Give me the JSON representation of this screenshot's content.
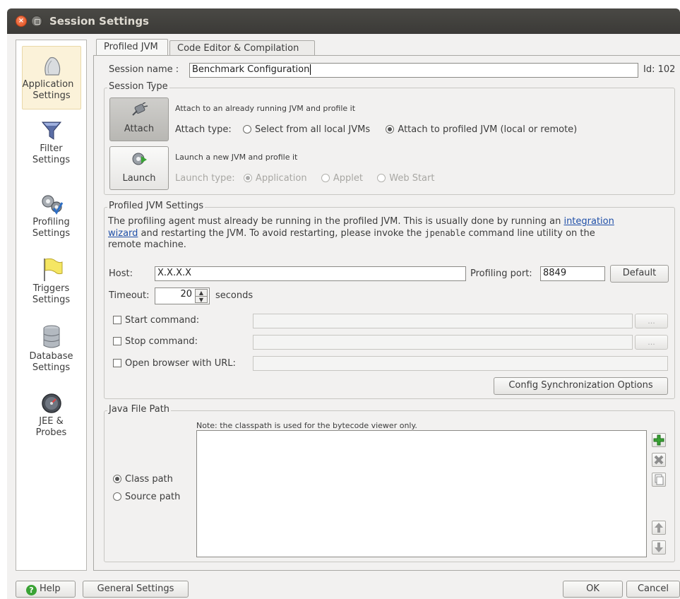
{
  "window": {
    "title": "Session Settings"
  },
  "sidebar": {
    "items": [
      {
        "label_line1": "Application",
        "label_line2": "Settings"
      },
      {
        "label_line1": "Filter",
        "label_line2": "Settings"
      },
      {
        "label_line1": "Profiling",
        "label_line2": "Settings"
      },
      {
        "label_line1": "Triggers",
        "label_line2": "Settings"
      },
      {
        "label_line1": "Database",
        "label_line2": "Settings"
      },
      {
        "label_line1": "JEE &",
        "label_line2": "Probes"
      }
    ]
  },
  "tabs": [
    {
      "label": "Profiled JVM"
    },
    {
      "label": "Code Editor & Compilation"
    }
  ],
  "session": {
    "name_label": "Session name :",
    "name_value": "Benchmark Configuration",
    "id_label": "Id: 102"
  },
  "session_type": {
    "title": "Session Type",
    "attach_button": "Attach",
    "attach_desc": "Attach to an already running JVM and profile it",
    "attach_type_label": "Attach type:",
    "attach_option_1": "Select from all local JVMs",
    "attach_option_2": "Attach to profiled JVM (local or remote)",
    "launch_button": "Launch",
    "launch_desc": "Launch a new JVM and profile it",
    "launch_type_label": "Launch type:",
    "launch_option_1": "Application",
    "launch_option_2": "Applet",
    "launch_option_3": "Web Start"
  },
  "profiled_jvm": {
    "title": "Profiled JVM Settings",
    "desc_1": "The profiling agent must already be running in the profiled JVM. This is usually done by running an",
    "link_1": "integration",
    "link_2": "wizard",
    "desc_2": "and restarting the JVM. To avoid restarting, please invoke the",
    "desc_code": "jpenable",
    "desc_3": "command line utility on the",
    "desc_4": "remote machine.",
    "host_label": "Host:",
    "host_value": "X.X.X.X",
    "port_label": "Profiling port:",
    "port_value": "8849",
    "default_button": "Default",
    "timeout_label": "Timeout:",
    "timeout_value": "20",
    "timeout_unit": "seconds",
    "start_command_label": "Start command:",
    "stop_command_label": "Stop command:",
    "open_browser_label": "Open browser with URL:",
    "browse_label": "...",
    "config_sync_button": "Config Synchronization Options"
  },
  "java_file_path": {
    "title": "Java File Path",
    "note": "Note: the classpath is used for the bytecode viewer only.",
    "class_path_label": "Class path",
    "source_path_label": "Source path"
  },
  "footer": {
    "help_button": "Help",
    "general_settings_button": "General Settings",
    "ok_button": "OK",
    "cancel_button": "Cancel"
  },
  "colors": {
    "titlebar": "#3b3a37",
    "selected_sidebar": "#fbf2d9",
    "link": "#1f4fa8",
    "add_icon": "#3aa335"
  }
}
